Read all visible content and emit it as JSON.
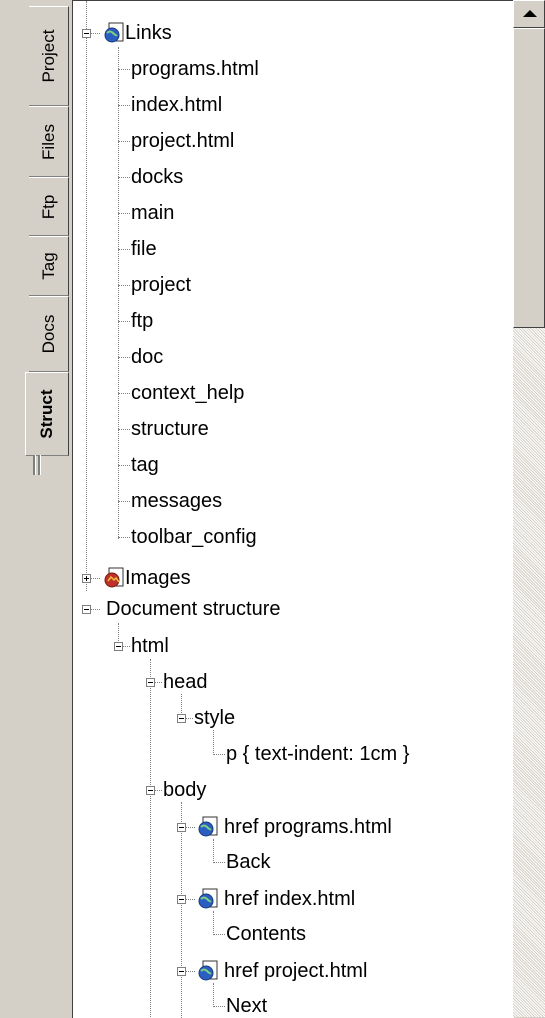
{
  "tabs": [
    {
      "label": "Project"
    },
    {
      "label": "Files"
    },
    {
      "label": "Ftp"
    },
    {
      "label": "Tag"
    },
    {
      "label": "Docs"
    },
    {
      "label": "Struct"
    }
  ],
  "links": {
    "label": "Links",
    "items": [
      "programs.html",
      "index.html",
      "project.html",
      "docks",
      "main",
      "file",
      "project",
      "ftp",
      "doc",
      "context_help",
      "structure",
      "tag",
      "messages",
      "toolbar_config"
    ]
  },
  "images": {
    "label": "Images"
  },
  "document": {
    "label": "Document structure",
    "html": "html",
    "head": "head",
    "style": "style",
    "style_rule": "p { text-indent: 1cm }",
    "body": "body",
    "anchors": [
      {
        "href": "href programs.html",
        "text": "Back"
      },
      {
        "href": "href index.html",
        "text": "Contents"
      },
      {
        "href": "href project.html",
        "text": "Next"
      }
    ]
  },
  "colors": {
    "panel": "#d4d0c8",
    "tree_bg": "#ffffff",
    "globe": "#2a5fbf"
  }
}
